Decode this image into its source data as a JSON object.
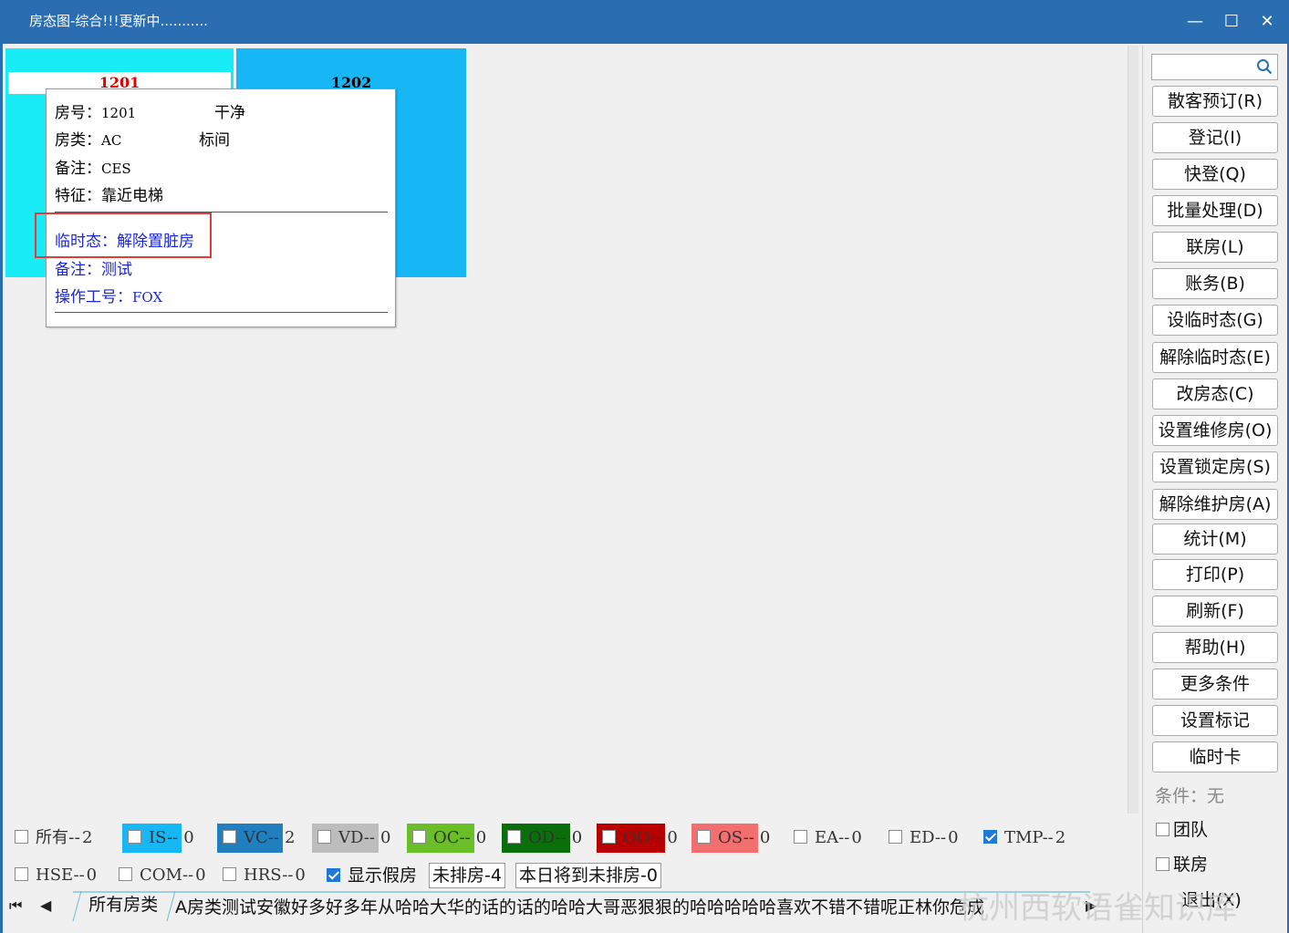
{
  "window": {
    "title": "房态图-综合!!!更新中...........",
    "minimize": "—",
    "maximize": "☐",
    "close": "✕"
  },
  "rooms": [
    {
      "number": "1201",
      "color": "#17ecf7",
      "number_color": "#e00000"
    },
    {
      "number": "1202",
      "color": "#17b6f5",
      "number_color": "#000000"
    }
  ],
  "tooltip": {
    "room_label": "房号：",
    "room_value": "1201",
    "state": "干净",
    "type_label": "房类：",
    "type_value": "AC",
    "type_name": "标间",
    "note_label": "备注：",
    "note_value": "CES",
    "feature_label": "特征：",
    "feature_value": "靠近电梯",
    "temp_label": "临时态：",
    "temp_value": "解除置脏房",
    "temp_note_label": "备注：",
    "temp_note_value": "测试",
    "operator_label": "操作工号：",
    "operator_value": "FOX"
  },
  "sidebar": {
    "search_placeholder": "",
    "buttons": [
      "散客预订(R)",
      "登记(I)",
      "快登(Q)",
      "批量处理(D)",
      "联房(L)",
      "账务(B)",
      "设临时态(G)",
      "解除临时态(E)",
      "改房态(C)",
      "设置维修房(O)",
      "设置锁定房(S)",
      "解除维护房(A)",
      "统计(M)",
      "打印(P)",
      "刷新(F)",
      "帮助(H)",
      "更多条件",
      "设置标记",
      "临时卡"
    ],
    "condition": "条件：无",
    "team": "团队",
    "linked": "联房",
    "exit": "退出(X)"
  },
  "legend": {
    "row1": [
      {
        "label": "所有--",
        "count": "2",
        "color": "",
        "checked": false
      },
      {
        "label": "IS--",
        "count": "0",
        "color": "#17b6f5",
        "checked": false
      },
      {
        "label": "VC--",
        "count": "2",
        "color": "#1f7fbf",
        "checked": false
      },
      {
        "label": "VD--",
        "count": "0",
        "color": "#bdbdbd",
        "checked": false
      },
      {
        "label": "OC--",
        "count": "0",
        "color": "#6abf28",
        "checked": false
      },
      {
        "label": "OD--",
        "count": "0",
        "color": "#0a6e0a",
        "checked": false
      },
      {
        "label": "OO--",
        "count": "0",
        "color": "#b80000",
        "checked": false
      },
      {
        "label": "OS--",
        "count": "0",
        "color": "#f36e6e",
        "checked": false
      },
      {
        "label": "EA--",
        "count": "0",
        "color": "",
        "checked": false
      },
      {
        "label": "ED--",
        "count": "0",
        "color": "",
        "checked": false
      },
      {
        "label": "TMP--",
        "count": "2",
        "color": "",
        "checked": true
      }
    ],
    "row2": [
      {
        "label": "HSE--",
        "count": "0",
        "checked": false
      },
      {
        "label": "COM--",
        "count": "0",
        "checked": false
      },
      {
        "label": "HRS--",
        "count": "0",
        "checked": false
      },
      {
        "label": "显示假房",
        "count": "",
        "checked": true
      }
    ],
    "unassigned": "未排房-4",
    "today_unassigned": "本日将到未排房-0"
  },
  "bottom": {
    "first_icon": "first-page-icon",
    "prev_icon": "prev-icon",
    "next_icon": "next-icon",
    "tab_all": "所有房类",
    "tab_a": "A房类测试安徽好多好多年从哈哈大华的话的话的哈哈大哥恶狠狠的哈哈哈哈哈喜欢不错不错呢正林你危成",
    "watermark": "杭州西软语雀知识库"
  }
}
